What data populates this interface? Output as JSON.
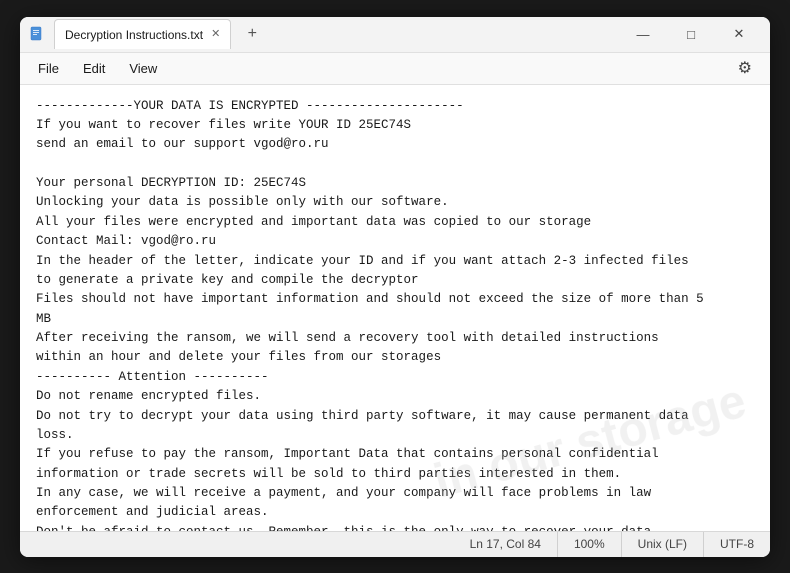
{
  "window": {
    "title": "Decryption Instructions.txt",
    "new_tab_label": "+",
    "controls": {
      "minimize": "—",
      "maximize": "□",
      "close": "✕"
    }
  },
  "menu": {
    "items": [
      "File",
      "Edit",
      "View"
    ],
    "settings_icon": "⚙"
  },
  "editor": {
    "content": "-------------YOUR DATA IS ENCRYPTED ---------------------\nIf you want to recover files write YOUR ID 25EC74S\nsend an email to our support vgod@ro.ru\n\nYour personal DECRYPTION ID: 25EC74S\nUnlocking your data is possible only with our software.\nAll your files were encrypted and important data was copied to our storage\nContact Mail: vgod@ro.ru\nIn the header of the letter, indicate your ID and if you want attach 2-3 infected files\nto generate a private key and compile the decryptor\nFiles should not have important information and should not exceed the size of more than 5\nMB\nAfter receiving the ransom, we will send a recovery tool with detailed instructions\nwithin an hour and delete your files from our storages\n---------- Attention ----------\nDo not rename encrypted files.\nDo not try to decrypt your data using third party software, it may cause permanent data\nloss.\nIf you refuse to pay the ransom, Important Data that contains personal confidential\ninformation or trade secrets will be sold to third parties interested in them.\nIn any case, we will receive a payment, and your company will face problems in law\nenforcement and judicial areas.\nDon't be afraid to contact us. Remember, this is the only way to recover your data."
  },
  "watermark": {
    "line1": "in our storage"
  },
  "status_bar": {
    "position": "Ln 17, Col 84",
    "zoom": "100%",
    "line_ending": "Unix (LF)",
    "encoding": "UTF-8"
  }
}
